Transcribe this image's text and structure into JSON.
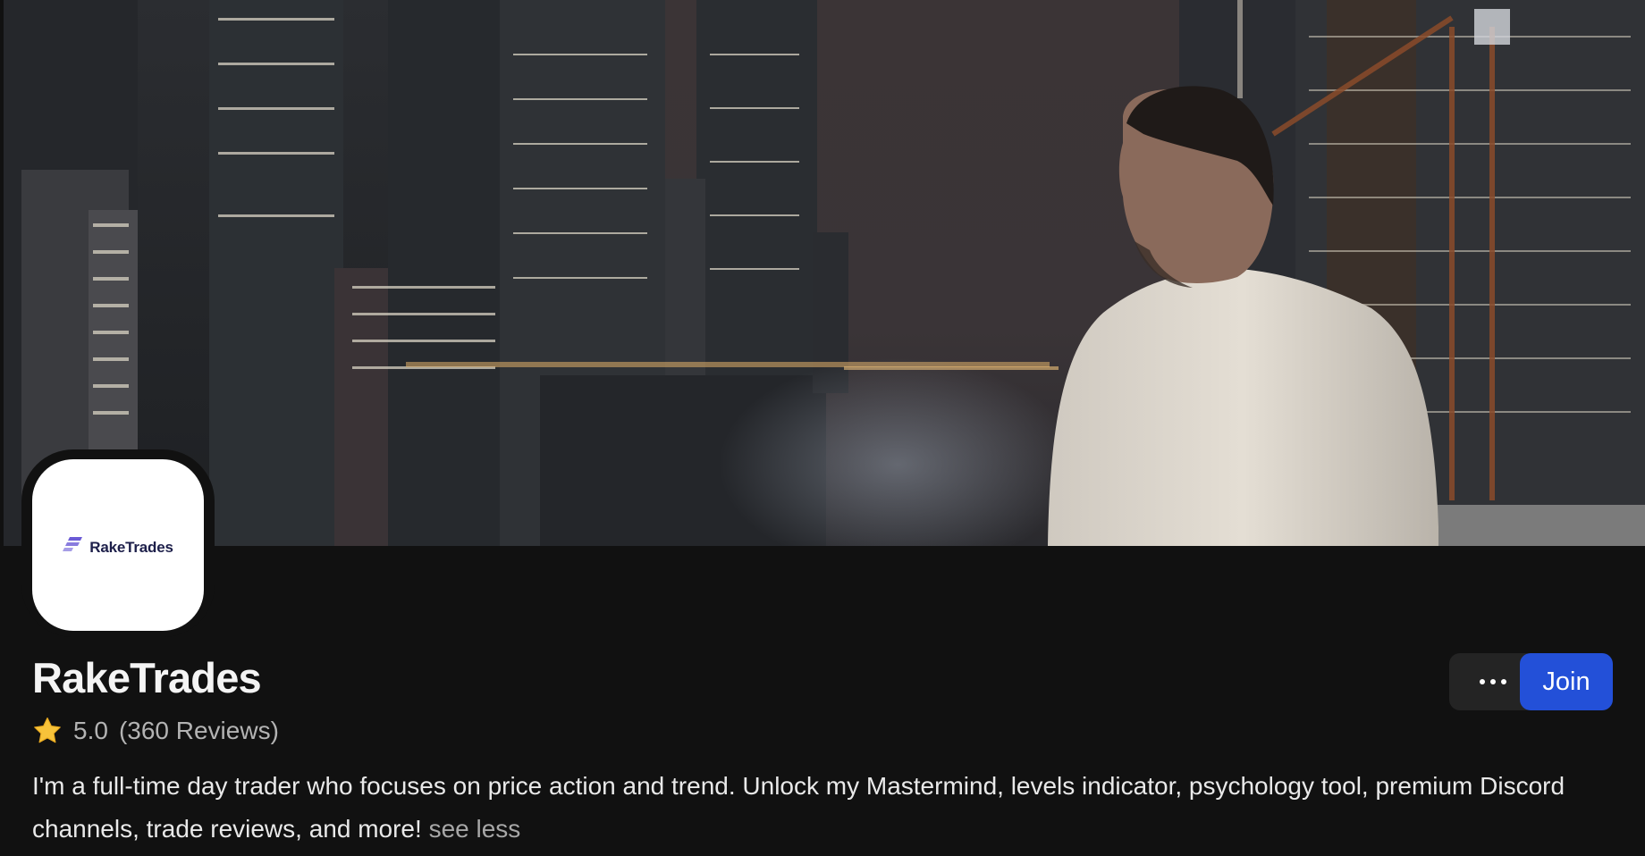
{
  "banner": {
    "alt": "Night city skyline with a man on a balcony"
  },
  "brand": {
    "logo_text": "RakeTrades",
    "name": "RakeTrades",
    "accent_color": "#2350d8",
    "logo_color": "#6b5bd6"
  },
  "rating": {
    "icon": "star-icon",
    "score": "5.0",
    "reviews": "(360 Reviews)",
    "star_color": "#f7c33a"
  },
  "description": {
    "text": "I'm a full-time day trader who focuses on price action and trend. Unlock my Mastermind, levels indicator, psychology tool, premium Discord channels, trade reviews, and more!",
    "toggle_label": "see less"
  },
  "actions": {
    "more_icon": "more-horizontal-icon",
    "join_label": "Join"
  }
}
